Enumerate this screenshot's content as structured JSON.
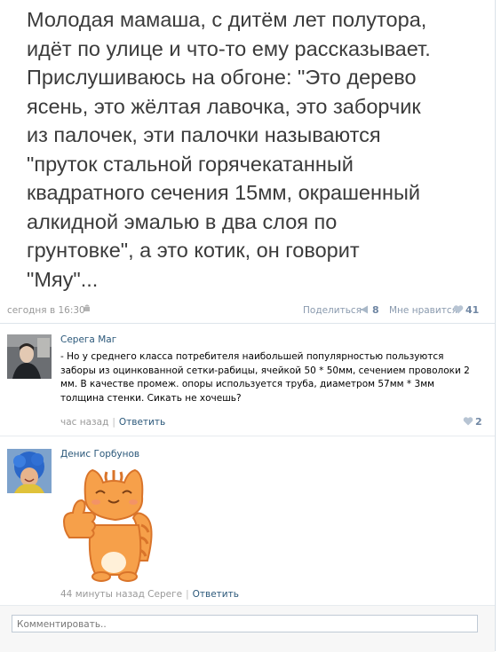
{
  "post": {
    "text": "Молодая мамаша, с дитём лет полутора,\nидёт по улице и что-то ему рассказывает.\nПрислушиваюсь на обгоне: \"Это дерево\nясень, это жёлтая лавочка, это заборчик\nиз палочек, эти палочки называются\n\"пруток стальной горячекатанный\nквадратного сечения 15мм, окрашенный\nалкидной эмалью в два слоя по\nгрунтовке\", а это котик, он говорит\n\"Мяу\"..."
  },
  "meta": {
    "time": "сегодня в 16:30",
    "share_label": "Поделиться",
    "share_count": "8",
    "like_label": "Мне нравится",
    "like_count": "41"
  },
  "comments": [
    {
      "author": "Серега Маг",
      "text": "- Но у среднего класса потребителя наибольшей популярностью пользуются заборы из оцинкованной сетки-рабицы, ячейкой 50 * 50мм, сечением проволоки 2 мм. В качестве промеж. опоры используется труба, диаметром 57мм * 3мм толщина стенки. Сикать не хочешь?",
      "time": "час назад",
      "reply_label": "Ответить",
      "likes": "2"
    },
    {
      "author": "Денис Горбунов",
      "time": "44 минуты назад Сереге",
      "reply_label": "Ответить"
    }
  ],
  "comment_input": {
    "placeholder": "Комментировать.."
  },
  "colors": {
    "link": "#2b587a",
    "meta_text": "#999999",
    "count": "#6f86a3",
    "sticker_orange": "#f6a04a"
  }
}
